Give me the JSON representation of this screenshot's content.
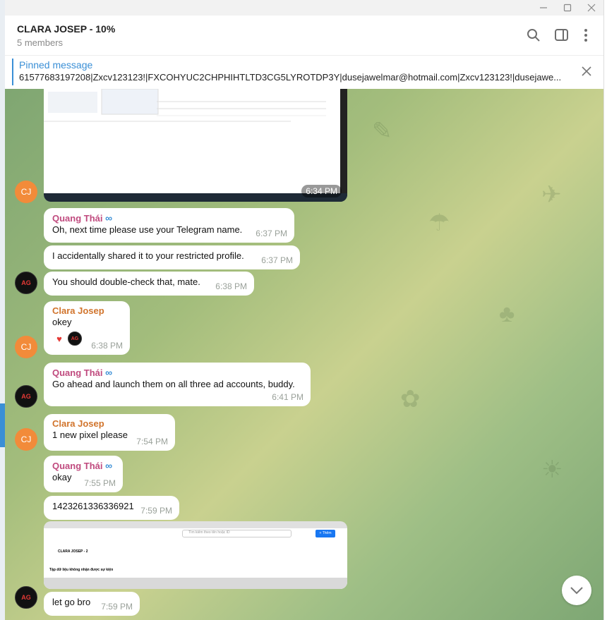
{
  "window": {
    "title": "CLARA JOSEP - 10%",
    "members": "5 members"
  },
  "pinned": {
    "title": "Pinned message",
    "text": "61577683197208|Zxcv123123!|FXCOHYUC2CHPHIHTLTD3CG5LYROTDP3Y|dusejawelmar@hotmail.com|Zxcv123123!|dusejawe..."
  },
  "messages": [
    {
      "time": "6:34 PM"
    },
    {
      "sender": "Quang Thái",
      "text": "Oh, next time please use your Telegram name.",
      "time": "6:37 PM"
    },
    {
      "text": "I accidentally shared it to your restricted profile.",
      "time": "6:37 PM"
    },
    {
      "text": "You should double-check that, mate.",
      "time": "6:38 PM"
    },
    {
      "sender": "Clara Josep",
      "text": "okey",
      "time": "6:38 PM"
    },
    {
      "sender": "Quang Thái",
      "text": "Go ahead and launch them on all three ad accounts, buddy.",
      "time": "6:41 PM"
    },
    {
      "sender": "Clara Josep",
      "text": "1 new pixel please",
      "time": "7:54 PM"
    },
    {
      "sender": "Quang Thái",
      "text": "okay",
      "time": "7:55 PM"
    },
    {
      "text": "1423261336336921",
      "time": "7:59 PM"
    },
    {
      "text": "let go bro",
      "time": "7:59 PM"
    }
  ],
  "avatars": {
    "cj": "CJ"
  },
  "screenshot2": {
    "title": "CLARA JOSEP - 2",
    "subtitle": "Tập dữ liệu không nhận được sự kiện",
    "search": "Tìm kiếm theo tên hoặc ID",
    "btn": "+ Thêm"
  },
  "icons": [
    "minimize-icon",
    "maximize-icon",
    "close-icon",
    "search-icon",
    "sidebar-icon",
    "more-vert-icon",
    "pin-close-icon",
    "meta-icon",
    "heart-icon",
    "chevron-down-icon"
  ],
  "colors": {
    "accent": "#3a8fd6",
    "qt_name": "#c04a7e",
    "cj_name": "#d1742c",
    "cj_avatar": "#f28b3a"
  }
}
